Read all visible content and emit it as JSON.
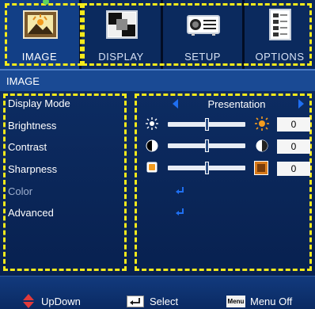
{
  "tabs": [
    {
      "label": "IMAGE",
      "icon": "image-icon",
      "active": true
    },
    {
      "label": "DISPLAY",
      "icon": "display-icon",
      "active": false
    },
    {
      "label": "SETUP",
      "icon": "projector-icon",
      "active": false
    },
    {
      "label": "OPTIONS",
      "icon": "options-icon",
      "active": false
    }
  ],
  "header": {
    "title": "IMAGE"
  },
  "menu": {
    "items": [
      "Display Mode",
      "Brightness",
      "Contrast",
      "Sharpness",
      "Color",
      "Advanced"
    ]
  },
  "display_mode": {
    "value": "Presentation"
  },
  "brightness": {
    "value": "0",
    "level": 0.5
  },
  "contrast": {
    "value": "0",
    "level": 0.5
  },
  "sharpness": {
    "value": "0",
    "level": 0.5
  },
  "footer": {
    "updown": "UpDown",
    "select": "Select",
    "menu_key": "Menu",
    "menu_off": "Menu Off"
  },
  "colors": {
    "highlight": "#f5ea1b",
    "arrow": "#1f6ff2",
    "active_tab": "#123f86"
  }
}
